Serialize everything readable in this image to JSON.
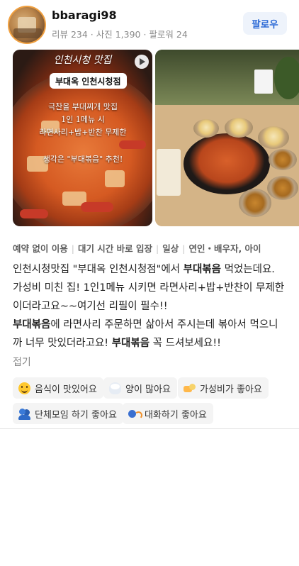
{
  "review": {
    "username": "bbaragi98",
    "stats": "리뷰 234 · 사진 1,390 · 팔로워 24",
    "follow_label": "팔로우"
  },
  "photo1": {
    "caption_top": "인천시청 맛집",
    "pill_label": "부대옥 인천시청점",
    "handwriting": [
      "극찬을 부대찌개 맛집",
      "1인 1메뉴 시",
      "라면사리+밥+반찬 무제한",
      "생각은 \"부대볶음\" 추천!"
    ]
  },
  "tags": [
    "예약 없이 이용",
    "대기 시간 바로 입장",
    "일상",
    "연인・배우자, 아이"
  ],
  "body": {
    "l1a": "인천시청맛집 \"부대옥 인천시청점\"에서 ",
    "l1b": "부대볶음",
    "l1c": " 먹었는데요.",
    "l2": "가성비 미친 집! 1인1메뉴 시키면 라면사리+밥+반찬이 무제한",
    "l3": "이더라고요~~여기선 리필이 필수!!",
    "l4a": "부대볶음",
    "l4b": "에 라면사리 주문하면 삶아서 주시는데 볶아서 먹으니",
    "l5a": "까 너무 맛있더라고요! ",
    "l5b": "부대볶음",
    "l5c": " 꼭 드셔보세요!!"
  },
  "collapse_label": "접기",
  "keywords": [
    {
      "icon": "smile-emoji-icon",
      "label": "음식이 맛있어요"
    },
    {
      "icon": "rice-bowl-icon",
      "label": "양이 많아요"
    },
    {
      "icon": "money-icon",
      "label": "가성비가 좋아요"
    },
    {
      "icon": "group-people-icon",
      "label": "단체모임 하기 좋아요"
    },
    {
      "icon": "talking-icon",
      "label": "대화하기 좋아요"
    }
  ]
}
